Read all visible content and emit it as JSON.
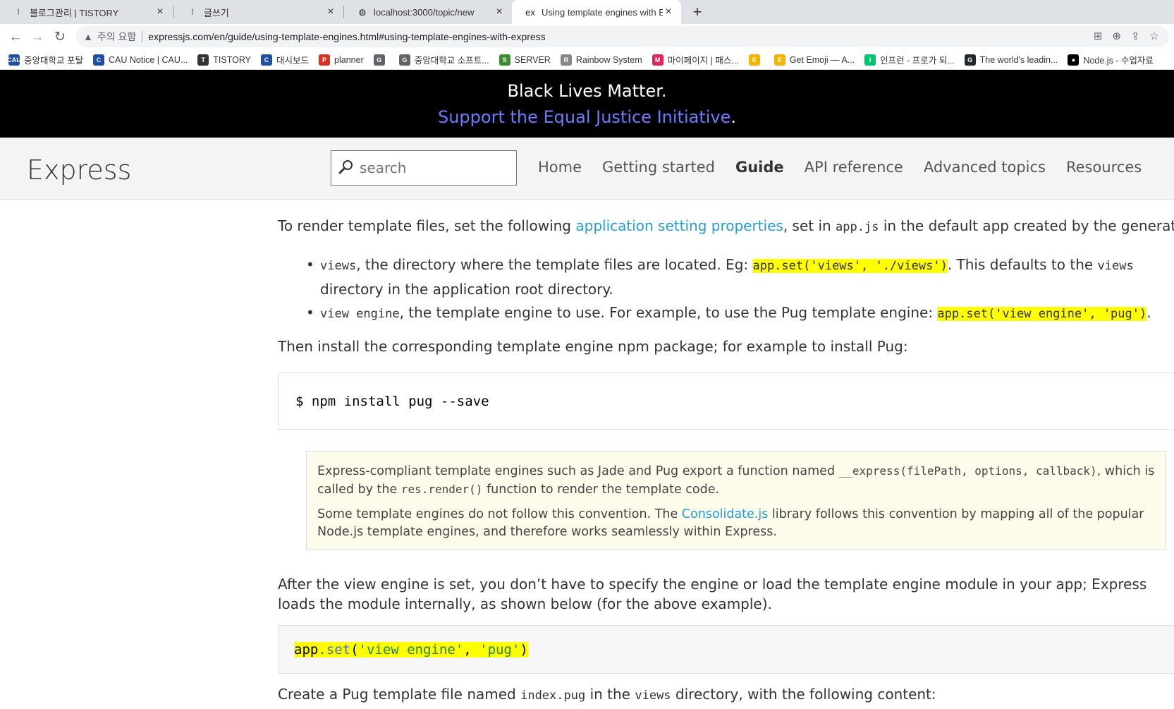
{
  "browser": {
    "tabs": [
      {
        "title": "블로그관리 | TISTORY",
        "close": "×"
      },
      {
        "title": "글쓰기",
        "close": "×"
      },
      {
        "title": "localhost:3000/topic/new",
        "close": "×"
      },
      {
        "title": "Using template engines with Ex",
        "close": "×"
      }
    ],
    "new_tab": "+",
    "not_secure": "주의 요함",
    "url": "expressjs.com/en/guide/using-template-engines.html#using-template-engines-with-express",
    "bookmarks": [
      {
        "label": "중앙대학교 포탈",
        "icon": "CAU",
        "color": "#1e4fa3"
      },
      {
        "label": "CAU Notice | CAU...",
        "icon": "C",
        "color": "#1e4fa3"
      },
      {
        "label": "TISTORY",
        "icon": "T",
        "color": "#333333"
      },
      {
        "label": "대시보드",
        "icon": "C",
        "color": "#1e4fa3"
      },
      {
        "label": "planner",
        "icon": "P",
        "color": "#d93025"
      },
      {
        "label": "",
        "icon": "G",
        "color": "#5f6368"
      },
      {
        "label": "중앙대학교 소프트...",
        "icon": "G",
        "color": "#5f6368"
      },
      {
        "label": "SERVER",
        "icon": "S",
        "color": "#3c8d2f"
      },
      {
        "label": "Rainbow System",
        "icon": "R",
        "color": "#888888"
      },
      {
        "label": "마이페이지 | 패스...",
        "icon": "M",
        "color": "#e0245e"
      },
      {
        "label": "",
        "icon": "E",
        "color": "#f4b400"
      },
      {
        "label": "Get Emoji — A...",
        "icon": "E",
        "color": "#f4b400"
      },
      {
        "label": "인프런 - 프로가 되...",
        "icon": "I",
        "color": "#00c471"
      },
      {
        "label": "The world's leadin...",
        "icon": "G",
        "color": "#24292e"
      },
      {
        "label": "Node.js - 수업자료",
        "icon": "●",
        "color": "#000000"
      }
    ]
  },
  "banner": {
    "line1": "Black Lives Matter.",
    "link": "Support the Equal Justice Initiative",
    "period": "."
  },
  "site": {
    "logo": "Express",
    "search_placeholder": "search",
    "menu": [
      "Home",
      "Getting started",
      "Guide",
      "API reference",
      "Advanced topics",
      "Resources"
    ],
    "active_menu": "Guide"
  },
  "content": {
    "p1": {
      "a": "To render template files, set the following ",
      "link": "application setting properties",
      "b": ", set in ",
      "code": "app.js",
      "c": " in the default app created by the generator:"
    },
    "li1": {
      "code1": "views",
      "a": ", the directory where the template files are located. Eg: ",
      "code2": "app.set('views', './views')",
      "b": ". This defaults to the ",
      "code3": "views",
      "c": " directory in the application root directory."
    },
    "li2": {
      "code1": "view engine",
      "a": ", the template engine to use. For example, to use the Pug template engine: ",
      "code2": "app.set('view engine', 'pug')",
      "b": "."
    },
    "p2": "Then install the corresponding template engine npm package; for example to install Pug:",
    "code_install": "$ npm install pug --save",
    "note": {
      "p1a": "Express-compliant template engines such as Jade and Pug export a function named ",
      "p1code": "__express(filePath, options, callback)",
      "p1b": ", which is called by the ",
      "p1code2": "res.render()",
      "p1c": " function to render the template code.",
      "p2a": "Some template engines do not follow this convention. The ",
      "p2link": "Consolidate.js",
      "p2b": " library follows this convention by mapping all of the popular Node.js template engines, and therefore works seamlessly within Express."
    },
    "p3": "After the view engine is set, you don’t have to specify the engine or load the template engine module in your app; Express loads the module internally, as shown below (for the above example).",
    "code_set": {
      "obj": "app",
      "method": ".set",
      "open": "(",
      "arg1": "'view engine'",
      "comma": ", ",
      "arg2": "'pug'",
      "close": ")"
    },
    "p4": {
      "a": "Create a Pug template file named ",
      "code1": "index.pug",
      "b": " in the ",
      "code2": "views",
      "c": " directory, with the following content:"
    }
  }
}
